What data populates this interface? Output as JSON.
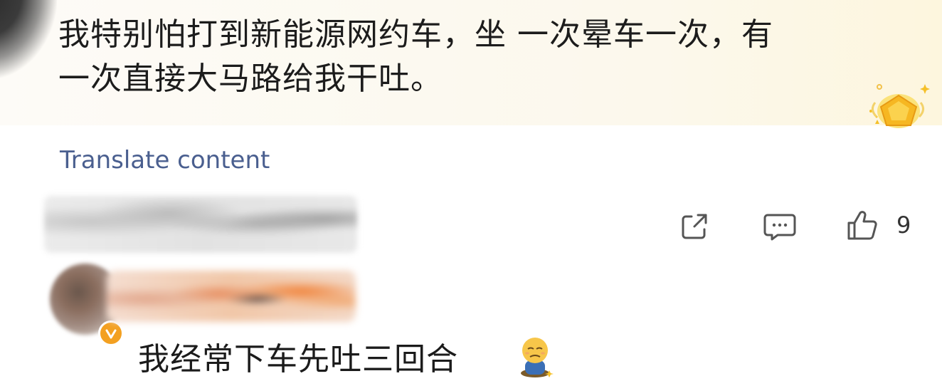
{
  "post": {
    "text_line1": "我特别怕打到新能源网约车，坐 一次晕车一次，有",
    "text_line2": "一次直接大马路给我干吐。"
  },
  "translate": {
    "label": "Translate content"
  },
  "actions": {
    "share_icon": "share-icon",
    "comment_icon": "comment-icon",
    "like_icon": "thumbs-up-icon",
    "like_count": "9"
  },
  "reply": {
    "text": "我经常下车先吐三回合",
    "emoji": "face-with-vomiting-emoji"
  },
  "colors": {
    "link": "#4a5f8f",
    "badge_gold": "#f5c028",
    "vip_orange": "#f3a021"
  }
}
